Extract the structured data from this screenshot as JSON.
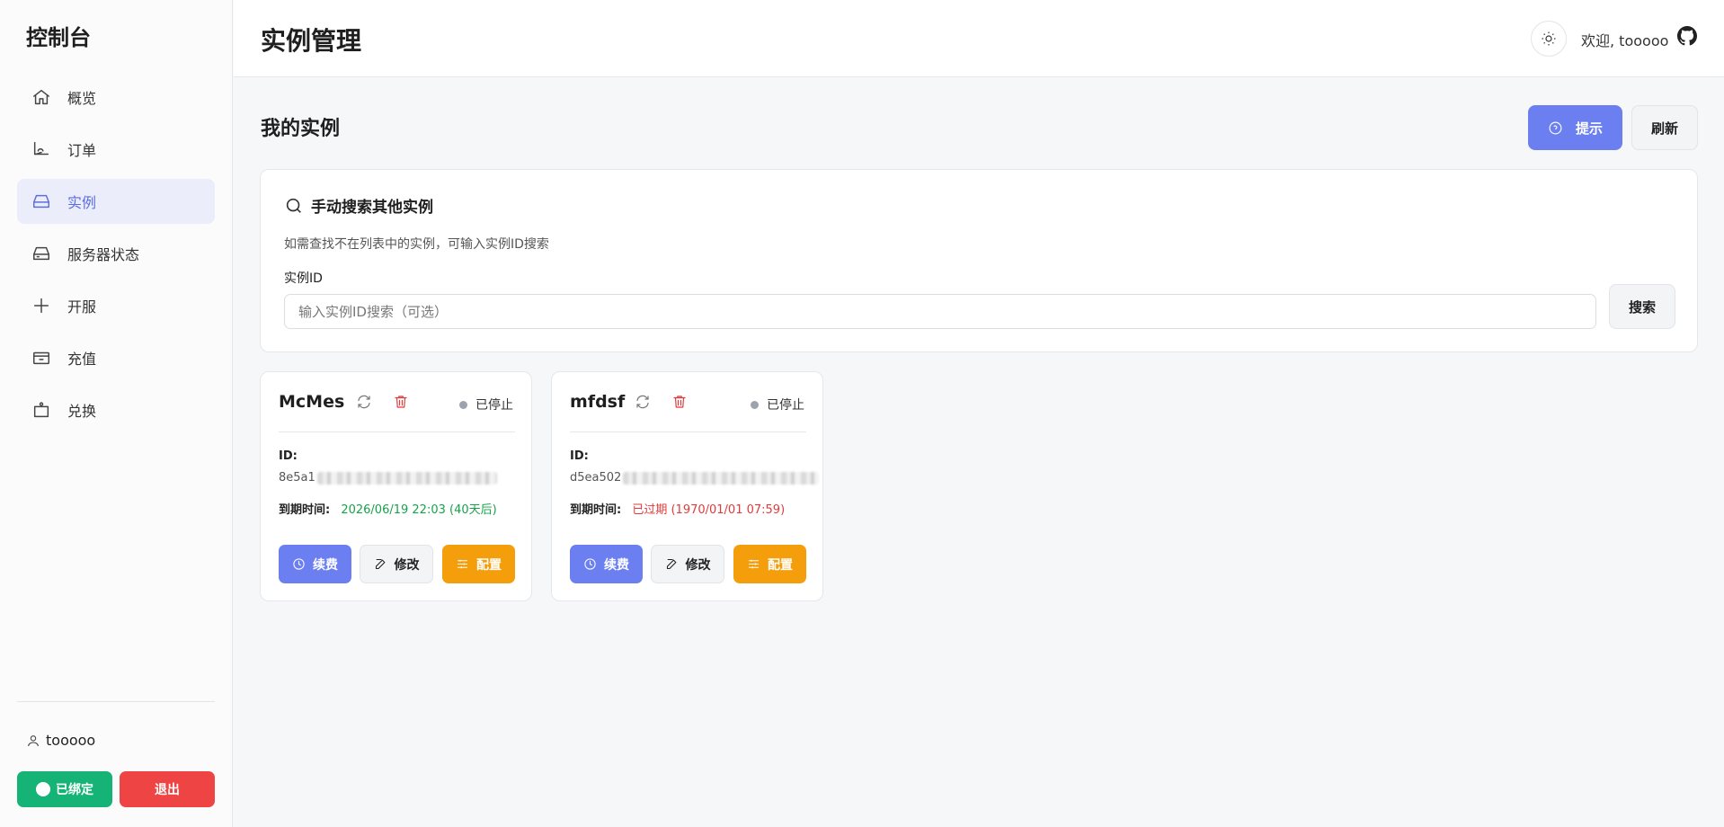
{
  "sidebar": {
    "brand": "控制台",
    "items": [
      {
        "label": "概览",
        "icon": "home-icon"
      },
      {
        "label": "订单",
        "icon": "order-icon"
      },
      {
        "label": "实例",
        "icon": "instance-icon"
      },
      {
        "label": "服务器状态",
        "icon": "server-icon"
      },
      {
        "label": "开服",
        "icon": "plus-icon"
      },
      {
        "label": "充值",
        "icon": "wallet-icon"
      },
      {
        "label": "兑换",
        "icon": "bag-icon"
      }
    ],
    "active_index": 2,
    "username": "tooooo",
    "bind_label": "已绑定",
    "logout_label": "退出"
  },
  "header": {
    "title": "实例管理",
    "welcome": "欢迎, tooooo"
  },
  "main": {
    "section_title": "我的实例",
    "hint_label": "提示",
    "refresh_label": "刷新",
    "search": {
      "title": "手动搜索其他实例",
      "description": "如需查找不在列表中的实例，可输入实例ID搜索",
      "field_label": "实例ID",
      "placeholder": "输入实例ID搜索（可选）",
      "button_label": "搜索"
    },
    "instances": [
      {
        "name": "McMes",
        "status": "已停止",
        "id_label": "ID:",
        "id_prefix": "8e5a1",
        "expire_label": "到期时间:",
        "expire_value": "2026/06/19 22:03 (40天后)",
        "expire_state": "ok",
        "renew_label": "续费",
        "edit_label": "修改",
        "config_label": "配置"
      },
      {
        "name": "mfdsf",
        "status": "已停止",
        "id_label": "ID:",
        "id_prefix": "d5ea502",
        "expire_label": "到期时间:",
        "expire_value": "已过期 (1970/01/01 07:59)",
        "expire_state": "expired",
        "renew_label": "续费",
        "edit_label": "修改",
        "config_label": "配置"
      }
    ]
  },
  "colors": {
    "accent": "#6b7ff0",
    "success": "#16b377",
    "danger": "#ef4444",
    "warning": "#f59e0b",
    "expired_text": "#e23b3b",
    "ok_text": "#16a34a"
  }
}
